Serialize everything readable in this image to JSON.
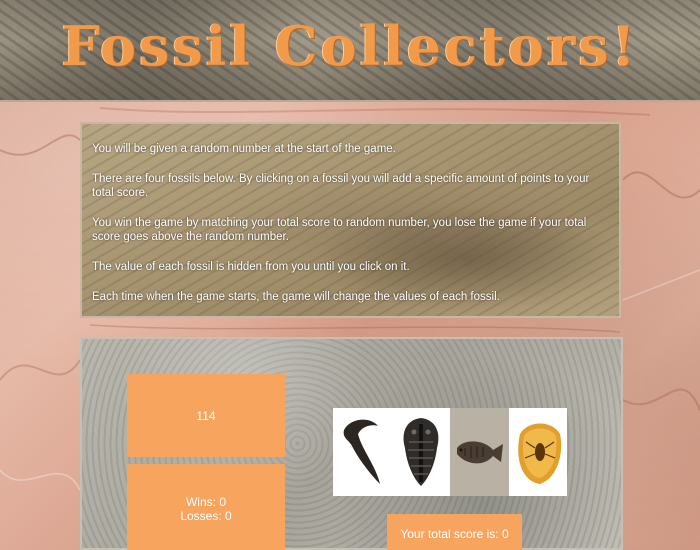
{
  "header": {
    "title": "Fossil Collectors!"
  },
  "instructions": {
    "lines": [
      "You will be given a random number at the start of the game.",
      "There are four fossils below. By clicking on a fossil you will add a specific amount of points to your total score.",
      "You win the game by matching your total score to random number, you lose the game if your total score goes above the random number.",
      "The value of each fossil is hidden from you until you click on it.",
      "Each time when the game starts, the game will change the values of each fossil."
    ]
  },
  "game": {
    "random_number": "114",
    "wins_label": "Wins: 0",
    "losses_label": "Losses: 0",
    "score_label": "Your total score is: 0",
    "fossils": [
      {
        "icon": "raptor-claw-icon"
      },
      {
        "icon": "trilobite-icon"
      },
      {
        "icon": "fish-fossil-icon"
      },
      {
        "icon": "amber-insect-icon"
      }
    ]
  },
  "colors": {
    "accent": "#f7a45e",
    "title": "#f19a4a"
  }
}
